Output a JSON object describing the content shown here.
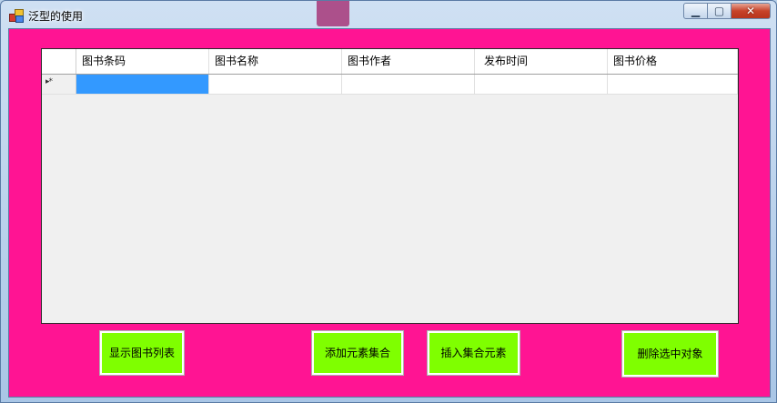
{
  "window": {
    "title": "泛型的使用",
    "close_glyph": "✕",
    "min_glyph": "▁",
    "max_glyph": "▢"
  },
  "colors": {
    "client_bg": "#ff1493",
    "button_bg": "#7fff00",
    "selection": "#3399ff"
  },
  "grid": {
    "columns": [
      "图书条码",
      "图书名称",
      "图书作者",
      "发布时间",
      "图书价格"
    ],
    "new_row_marker": "▸*",
    "rows": [
      {
        "cells": [
          "",
          "",
          "",
          "",
          ""
        ],
        "selected_cell": 0
      }
    ]
  },
  "buttons": {
    "show_list": "显示图书列表",
    "add_collection": "添加元素集合",
    "insert_collection": "插入集合元素",
    "delete_selected": "删除选中对象"
  }
}
